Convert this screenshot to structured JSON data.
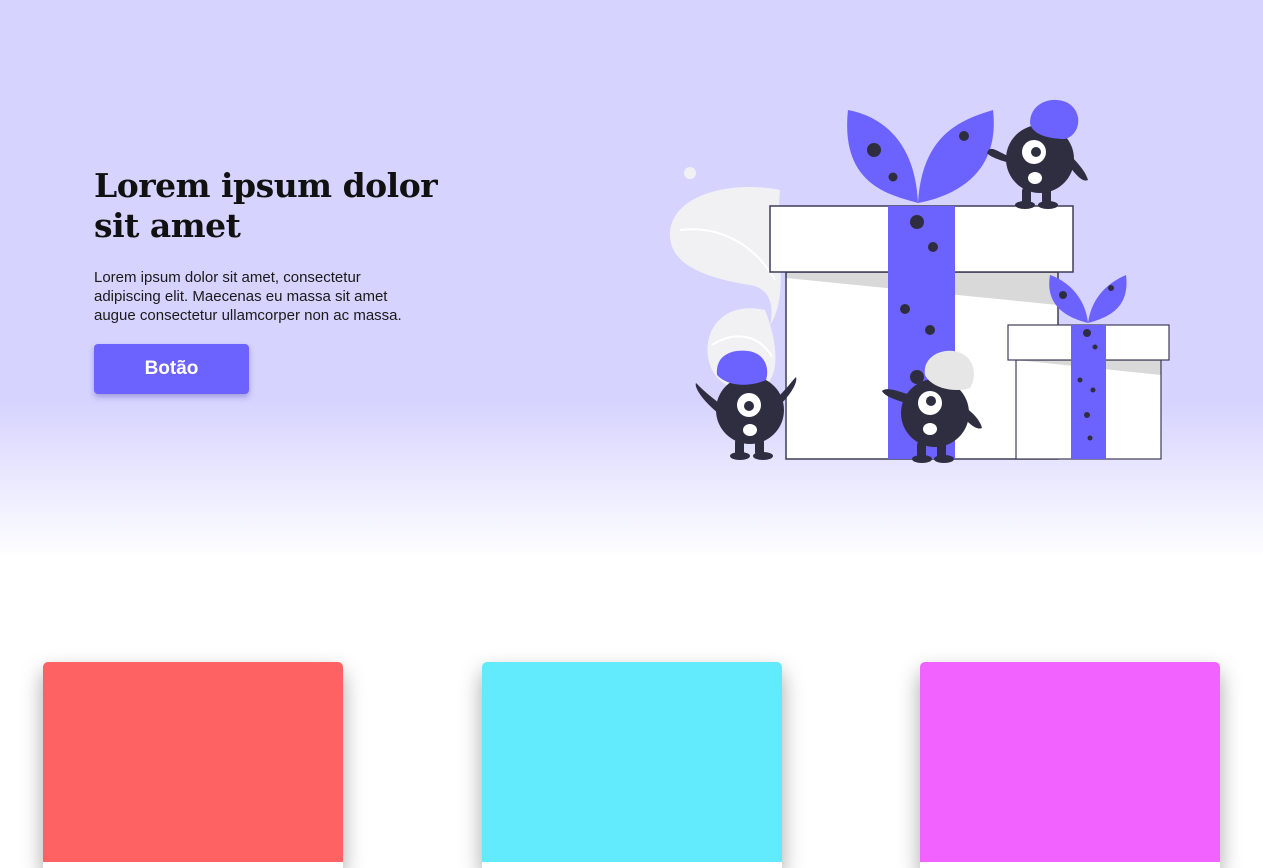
{
  "hero": {
    "title": "Lorem ipsum dolor sit amet",
    "text": "Lorem ipsum dolor sit amet, consectetur adipiscing elit. Maecenas eu massa sit amet augue consectetur ullamcorper non ac massa.",
    "button_label": "Botão",
    "illustration_icon": "gift-boxes-monsters-illustration"
  },
  "colors": {
    "hero_background": "#d6d3ff",
    "accent": "#6c63ff",
    "dark": "#2f2e41"
  },
  "cards": [
    {
      "color": "#ff6262"
    },
    {
      "color": "#62ebfc"
    },
    {
      "color": "#f262ff"
    }
  ]
}
